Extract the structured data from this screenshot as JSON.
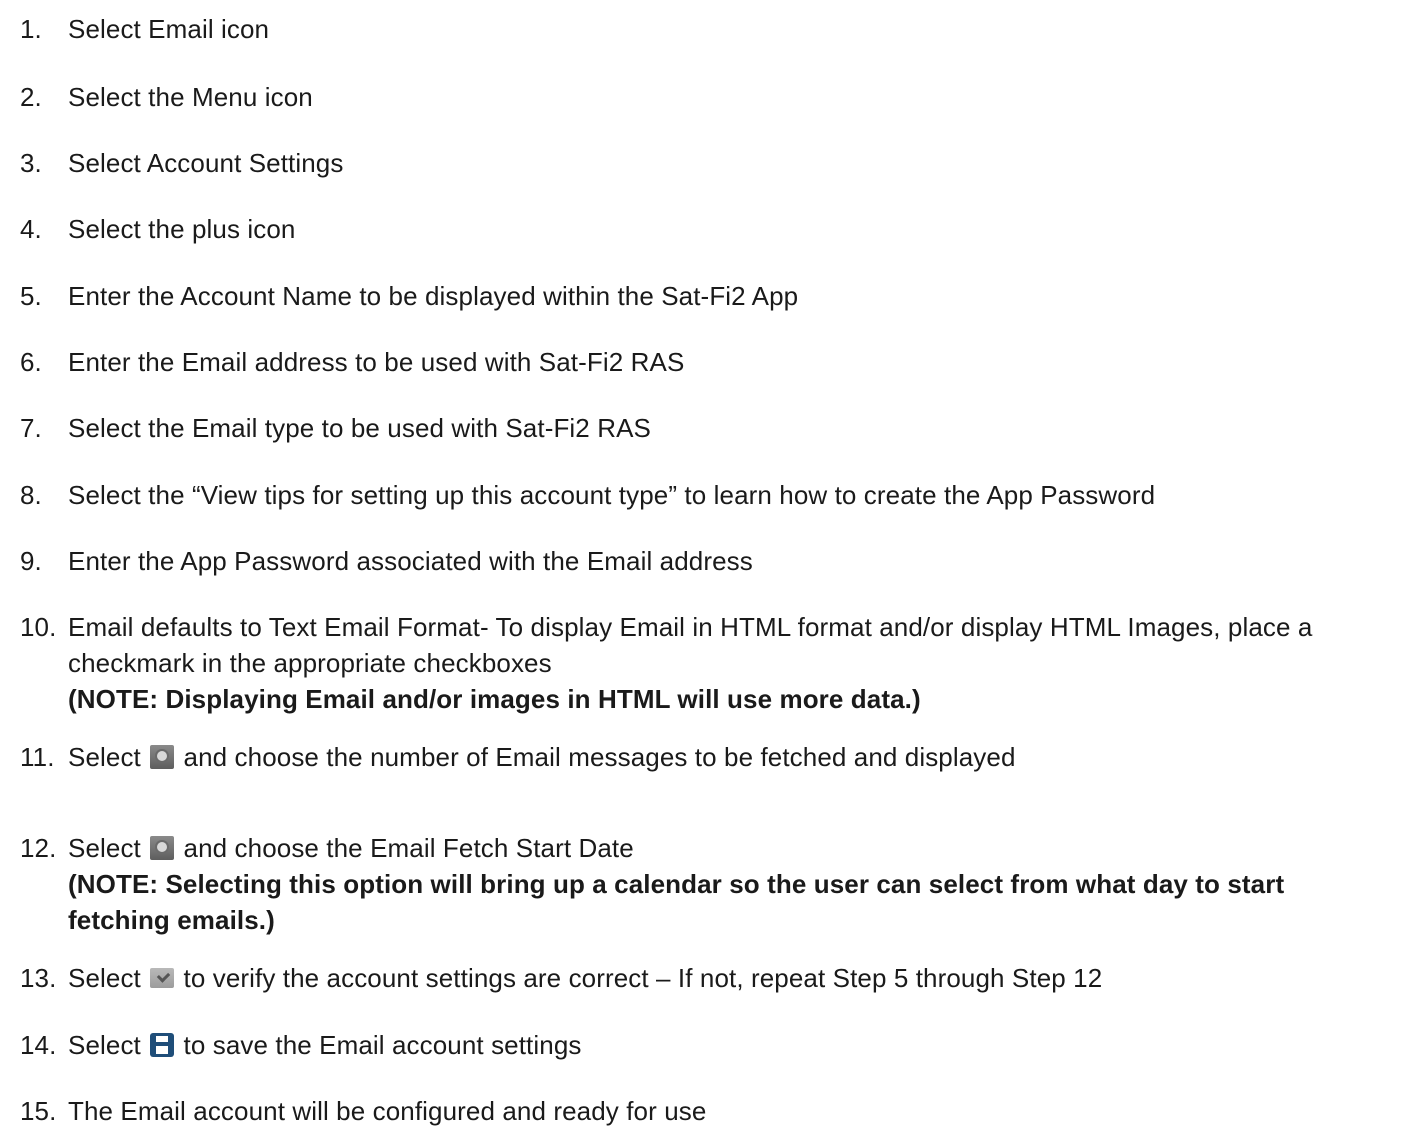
{
  "steps": [
    {
      "num": "1.",
      "text": "Select Email icon"
    },
    {
      "num": "2.",
      "text": "Select the Menu icon"
    },
    {
      "num": "3.",
      "text": "Select Account Settings"
    },
    {
      "num": "4.",
      "text": "Select the plus icon"
    },
    {
      "num": "5.",
      "text": "Enter the Account Name to be displayed within the Sat-Fi2 App"
    },
    {
      "num": "6.",
      "text": "Enter the Email address to be used with Sat-Fi2 RAS"
    },
    {
      "num": "7.",
      "text": "Select the Email type to be used with Sat-Fi2 RAS"
    },
    {
      "num": "8.",
      "text": "Select the “View tips for setting up this account type” to learn how to create the App Password"
    },
    {
      "num": "9.",
      "text": "Enter the App Password associated with the Email address"
    },
    {
      "num": "10.",
      "text": "Email defaults to Text Email Format- To display Email in HTML format and/or display HTML Images, place a",
      "text2": "checkmark in the appropriate checkboxes",
      "note": "(NOTE: Displaying Email and/or images in HTML will use more data.)"
    },
    {
      "num": "11.",
      "pre": "Select",
      "icon": "settings-icon",
      "post": "and choose the number of Email messages to be fetched and displayed"
    },
    {
      "num": "12.",
      "pre": "Select",
      "icon": "settings-icon",
      "post": "and choose the Email Fetch Start Date",
      "note1": "(NOTE: Selecting this option will bring up a calendar so the user can select from what day to start",
      "note2": "fetching emails.)"
    },
    {
      "num": "13.",
      "pre": "Select",
      "icon": "verify-check-icon",
      "post": "to verify the account settings are correct – If not, repeat Step 5 through Step 12"
    },
    {
      "num": "14.",
      "pre": "Select",
      "icon": "save-icon",
      "post": "to save the Email account settings"
    },
    {
      "num": "15.",
      "text": "The Email account will be configured and ready for use"
    }
  ]
}
